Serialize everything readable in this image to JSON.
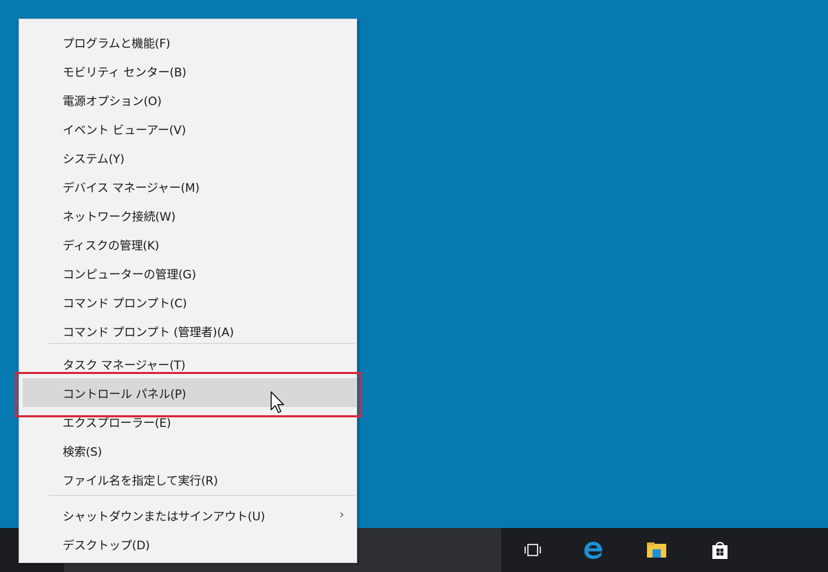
{
  "menu": {
    "groups": [
      [
        {
          "label": "プログラムと機能(F)"
        },
        {
          "label": "モビリティ センター(B)"
        },
        {
          "label": "電源オプション(O)"
        },
        {
          "label": "イベント ビューアー(V)"
        },
        {
          "label": "システム(Y)"
        },
        {
          "label": "デバイス マネージャー(M)"
        },
        {
          "label": "ネットワーク接続(W)"
        },
        {
          "label": "ディスクの管理(K)"
        },
        {
          "label": "コンピューターの管理(G)"
        },
        {
          "label": "コマンド プロンプト(C)"
        },
        {
          "label": "コマンド プロンプト (管理者)(A)"
        }
      ],
      [
        {
          "label": "タスク マネージャー(T)"
        },
        {
          "label": "コントロール パネル(P)"
        },
        {
          "label": "エクスプローラー(E)"
        },
        {
          "label": "検索(S)"
        },
        {
          "label": "ファイル名を指定して実行(R)"
        }
      ],
      [
        {
          "label": "シャットダウンまたはサインアウト(U)",
          "submenu_arrow": "›"
        },
        {
          "label": "デスクトップ(D)"
        }
      ]
    ],
    "hovered_item": "コントロール パネル(P)"
  },
  "taskbar": {
    "icons": [
      "task-view-icon",
      "edge-icon",
      "file-explorer-icon",
      "store-icon"
    ]
  },
  "colors": {
    "desktop": "#0779b1",
    "taskbar": "#1b1d22",
    "menu_background": "#f2f2f2",
    "hover": "#d8d8d8",
    "highlight_frame": "#d9263a",
    "edge_blue": "#1e90d6",
    "explorer_yellow": "#f2c744"
  }
}
